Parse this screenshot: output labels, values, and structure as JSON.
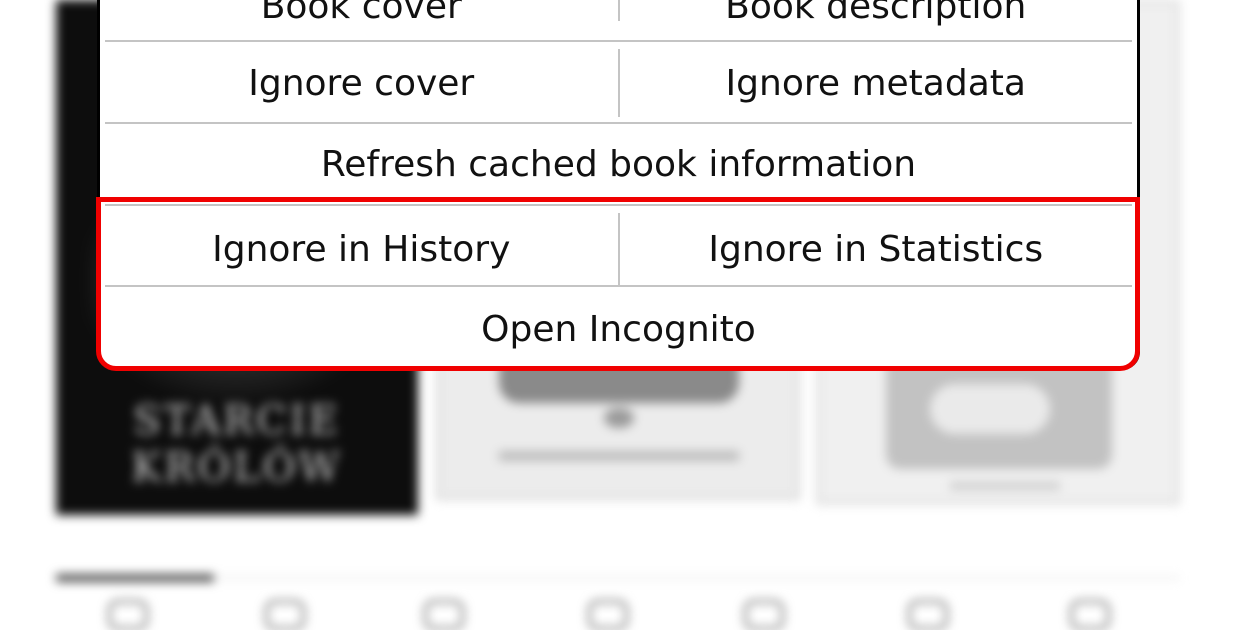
{
  "background_books": [
    {
      "title_line1": "STARCIE",
      "title_line2": "KRÓLÓW"
    }
  ],
  "menu": {
    "book_cover": "Book cover",
    "book_description": "Book description",
    "ignore_cover": "Ignore cover",
    "ignore_metadata": "Ignore metadata",
    "refresh_cached": "Refresh cached book information",
    "ignore_history": "Ignore in History",
    "ignore_statistics": "Ignore in Statistics",
    "open_incognito": "Open Incognito"
  },
  "colors": {
    "highlight": "#f00000",
    "dialog_border": "#000000",
    "separator": "#c4c4c4"
  }
}
